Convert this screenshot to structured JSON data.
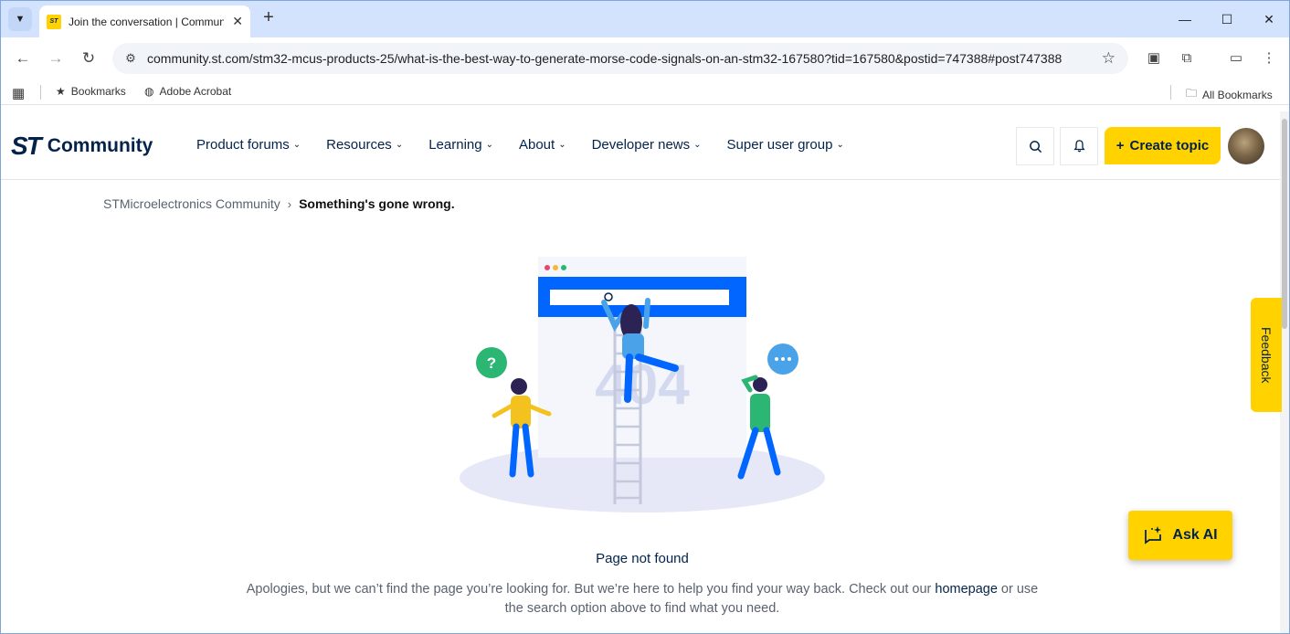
{
  "browser": {
    "tab_title": "Join the conversation | Community",
    "url": "community.st.com/stm32-mcus-products-25/what-is-the-best-way-to-generate-morse-code-signals-on-an-stm32-167580?tid=167580&postid=747388#post747388",
    "bookmarks": [
      "Bookmarks",
      "Adobe Acrobat"
    ],
    "all_bookmarks": "All Bookmarks"
  },
  "site": {
    "logo_mark": "ST",
    "logo_text": "Community",
    "nav": [
      "Product forums",
      "Resources",
      "Learning",
      "About",
      "Developer news",
      "Super user group"
    ],
    "create_topic": "Create topic",
    "colors": {
      "brand_yellow": "#ffd200",
      "brand_navy": "#03234b",
      "illustration_blue": "#0066ff"
    }
  },
  "breadcrumb": {
    "home": "STMicroelectronics Community",
    "current": "Something's gone wrong."
  },
  "illustration": {
    "code": "404"
  },
  "message": {
    "title": "Page not found",
    "body_before": "Apologies, but we can’t find the page you’re looking for. But we’re here to help you find your way back. Check out our ",
    "link": "homepage",
    "body_after": " or use the search option above to find what you need."
  },
  "feedback_label": "Feedback",
  "ask_ai_label": "Ask AI"
}
